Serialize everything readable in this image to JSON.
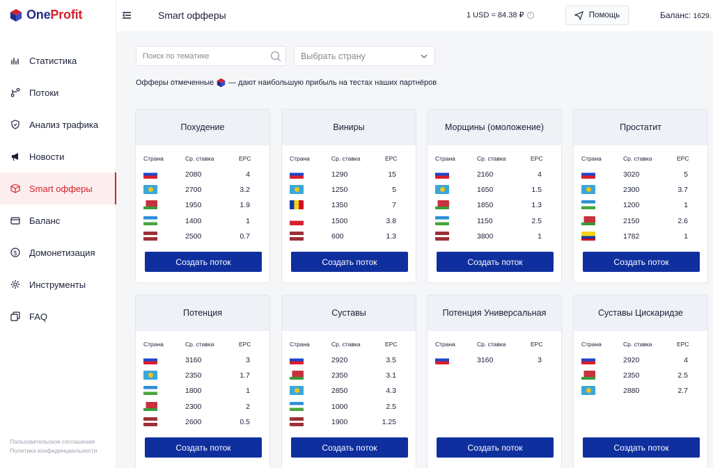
{
  "sidebar": {
    "brand_one": "One",
    "brand_profit": "Profit",
    "items": [
      {
        "label": "Статистика",
        "icon": "chart-icon"
      },
      {
        "label": "Потоки",
        "icon": "flow-icon"
      },
      {
        "label": "Анализ трафика",
        "icon": "shield-icon"
      },
      {
        "label": "Новости",
        "icon": "megaphone-icon"
      },
      {
        "label": "Smart офферы",
        "icon": "cube-icon"
      },
      {
        "label": "Баланс",
        "icon": "card-icon"
      },
      {
        "label": "Домонетизация",
        "icon": "dollar-icon"
      },
      {
        "label": "Инструменты",
        "icon": "gear-icon"
      },
      {
        "label": "FAQ",
        "icon": "copy-icon"
      }
    ],
    "active_index": 4,
    "footer": {
      "terms": "Пользовательское соглашение",
      "privacy": "Политика конфиденциальности"
    }
  },
  "header": {
    "title": "Smart офферы",
    "rate": "1 USD = 84.38 ₽",
    "help_label": "Помощь",
    "balance_label": "Баланс:",
    "balance_value": "1629."
  },
  "filters": {
    "search_placeholder": "Поиск по тематике",
    "country_placeholder": "Выбрать страну",
    "note_before": "Офферы отмеченные",
    "note_after": "— дают наибольшую прибыль на тестах наших партнёров"
  },
  "table_headers": {
    "country": "Страна",
    "rate": "Ср. ставка",
    "epc": "EPC"
  },
  "button_label": "Создать поток",
  "colors": {
    "accent": "#d6202c",
    "button": "#0f2f9e",
    "brand_blue": "#1f2d8c"
  },
  "offers": [
    {
      "title": "Похудение",
      "rows": [
        {
          "flag": "ru",
          "rate": "2080",
          "epc": "4"
        },
        {
          "flag": "kz",
          "rate": "2700",
          "epc": "3.2"
        },
        {
          "flag": "by",
          "rate": "1950",
          "epc": "1.9"
        },
        {
          "flag": "uz",
          "rate": "1400",
          "epc": "1"
        },
        {
          "flag": "lv",
          "rate": "2500",
          "epc": "0.7"
        }
      ]
    },
    {
      "title": "Виниры",
      "rows": [
        {
          "flag": "ru",
          "rate": "1290",
          "epc": "15"
        },
        {
          "flag": "kz",
          "rate": "1250",
          "epc": "5"
        },
        {
          "flag": "ro",
          "rate": "1350",
          "epc": "7"
        },
        {
          "flag": "pl",
          "rate": "1500",
          "epc": "3.8"
        },
        {
          "flag": "lv",
          "rate": "600",
          "epc": "1.3"
        }
      ]
    },
    {
      "title": "Морщины (омоложение)",
      "rows": [
        {
          "flag": "ru",
          "rate": "2160",
          "epc": "4"
        },
        {
          "flag": "kz",
          "rate": "1650",
          "epc": "1.5"
        },
        {
          "flag": "by",
          "rate": "1850",
          "epc": "1.3"
        },
        {
          "flag": "uz",
          "rate": "1150",
          "epc": "2.5"
        },
        {
          "flag": "lv",
          "rate": "3800",
          "epc": "1"
        }
      ]
    },
    {
      "title": "Простатит",
      "rows": [
        {
          "flag": "ru",
          "rate": "3020",
          "epc": "5"
        },
        {
          "flag": "kz",
          "rate": "2300",
          "epc": "3.7"
        },
        {
          "flag": "uz",
          "rate": "1200",
          "epc": "1"
        },
        {
          "flag": "by",
          "rate": "2150",
          "epc": "2.6"
        },
        {
          "flag": "co",
          "rate": "1782",
          "epc": "1"
        }
      ]
    },
    {
      "title": "Потенция",
      "rows": [
        {
          "flag": "ru",
          "rate": "3160",
          "epc": "3"
        },
        {
          "flag": "kz",
          "rate": "2350",
          "epc": "1.7"
        },
        {
          "flag": "uz",
          "rate": "1800",
          "epc": "1"
        },
        {
          "flag": "by",
          "rate": "2300",
          "epc": "2"
        },
        {
          "flag": "lv",
          "rate": "2600",
          "epc": "0.5"
        }
      ]
    },
    {
      "title": "Суставы",
      "rows": [
        {
          "flag": "ru",
          "rate": "2920",
          "epc": "3.5"
        },
        {
          "flag": "by",
          "rate": "2350",
          "epc": "3.1"
        },
        {
          "flag": "kz",
          "rate": "2850",
          "epc": "4.3"
        },
        {
          "flag": "uz",
          "rate": "1000",
          "epc": "2.5"
        },
        {
          "flag": "lv",
          "rate": "1900",
          "epc": "1.25"
        }
      ]
    },
    {
      "title": "Потенция Универсальная",
      "rows": [
        {
          "flag": "ru",
          "rate": "3160",
          "epc": "3"
        }
      ]
    },
    {
      "title": "Суставы Цискаридзе",
      "rows": [
        {
          "flag": "ru",
          "rate": "2920",
          "epc": "4"
        },
        {
          "flag": "by",
          "rate": "2350",
          "epc": "2.5"
        },
        {
          "flag": "kz",
          "rate": "2880",
          "epc": "2.7"
        }
      ]
    }
  ]
}
